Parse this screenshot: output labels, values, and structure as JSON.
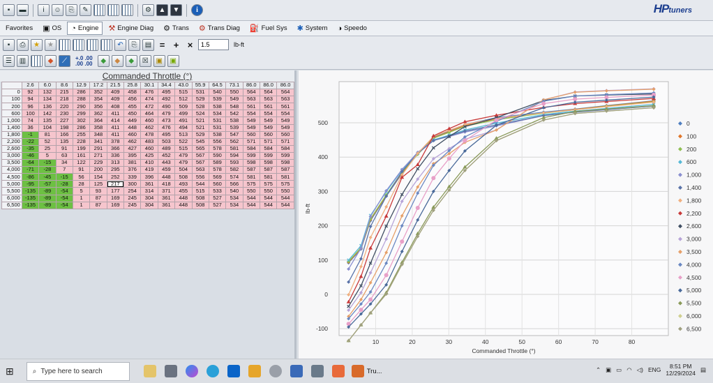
{
  "brand": {
    "logo_text": "HP",
    "logo_suffix": "tuners"
  },
  "nav_tabs": [
    {
      "label": "Favorites"
    },
    {
      "label": "OS"
    },
    {
      "label": "Engine"
    },
    {
      "label": "Engine Diag"
    },
    {
      "label": "Trans"
    },
    {
      "label": "Trans Diag"
    },
    {
      "label": "Fuel Sys"
    },
    {
      "label": "System"
    },
    {
      "label": "Speedo"
    }
  ],
  "editor": {
    "value_input": "1.5",
    "unit_label": "lb-ft",
    "decimals_up": "+.0 .00",
    "decimals_down": ".00 .00"
  },
  "table": {
    "title": "Commanded Throttle (°)",
    "col_headers": [
      "2.6",
      "6.0",
      "8.6",
      "12.9",
      "17.2",
      "21.5",
      "25.8",
      "30.1",
      "34.4",
      "43.0",
      "55.9",
      "64.5",
      "73.1",
      "86.0",
      "86.0",
      "86.0"
    ],
    "row_headers": [
      "0",
      "100",
      "200",
      "600",
      "1,000",
      "1,400",
      "1,800",
      "2,200",
      "2,600",
      "3,000",
      "3,500",
      "4,000",
      "4,500",
      "5,000",
      "5,500",
      "6,000",
      "6,500"
    ],
    "rows": [
      [
        92,
        132,
        215,
        286,
        352,
        409,
        458,
        476,
        495,
        515,
        531,
        540,
        550,
        564,
        564,
        564
      ],
      [
        94,
        134,
        218,
        288,
        354,
        409,
        456,
        474,
        492,
        512,
        529,
        539,
        549,
        563,
        563,
        563
      ],
      [
        96,
        136,
        220,
        290,
        356,
        408,
        455,
        472,
        490,
        509,
        528,
        538,
        548,
        561,
        561,
        561
      ],
      [
        100,
        142,
        230,
        299,
        362,
        411,
        450,
        464,
        479,
        499,
        524,
        534,
        542,
        554,
        554,
        554
      ],
      [
        74,
        135,
        227,
        302,
        364,
        414,
        449,
        460,
        473,
        491,
        521,
        531,
        538,
        549,
        549,
        549
      ],
      [
        36,
        104,
        198,
        286,
        358,
        411,
        448,
        462,
        476,
        494,
        521,
        531,
        539,
        549,
        549,
        549
      ],
      [
        -1,
        81,
        166,
        255,
        348,
        411,
        460,
        478,
        495,
        513,
        529,
        538,
        547,
        560,
        560,
        560
      ],
      [
        -22,
        52,
        135,
        228,
        341,
        378,
        462,
        483,
        503,
        522,
        545,
        556,
        562,
        571,
        571,
        571
      ],
      [
        -35,
        25,
        91,
        199,
        291,
        366,
        427,
        460,
        489,
        515,
        565,
        578,
        581,
        584,
        584,
        584
      ],
      [
        -46,
        5,
        63,
        161,
        271,
        336,
        395,
        425,
        452,
        479,
        567,
        590,
        594,
        599,
        599,
        599
      ],
      [
        -64,
        -15,
        34,
        122,
        229,
        313,
        381,
        410,
        443,
        479,
        567,
        589,
        593,
        598,
        598,
        598
      ],
      [
        -71,
        -28,
        7,
        91,
        200,
        295,
        376,
        419,
        459,
        504,
        563,
        578,
        582,
        587,
        587,
        587
      ],
      [
        -86,
        -45,
        -15,
        56,
        154,
        252,
        339,
        396,
        448,
        508,
        556,
        569,
        574,
        581,
        581,
        581
      ],
      [
        -95,
        -57,
        -28,
        28,
        125,
        217,
        300,
        361,
        418,
        493,
        544,
        560,
        566,
        575,
        575,
        575
      ],
      [
        -135,
        -89,
        -54,
        5,
        93,
        177,
        254,
        314,
        371,
        455,
        515,
        533,
        540,
        550,
        550,
        550
      ],
      [
        -135,
        -89,
        -54,
        1,
        87,
        169,
        245,
        304,
        361,
        448,
        508,
        527,
        534,
        544,
        544,
        544
      ],
      [
        -135,
        -89,
        -54,
        1,
        87,
        169,
        245,
        304,
        361,
        448,
        508,
        527,
        534,
        544,
        544,
        544
      ]
    ]
  },
  "chart_data": {
    "type": "line",
    "xlabel": "Commanded Throttle (°)",
    "ylabel": "lb-ft",
    "xlim": [
      0,
      90
    ],
    "ylim": [
      -120,
      620
    ],
    "xticks": [
      10,
      20,
      30,
      40,
      50,
      60,
      70,
      80
    ],
    "yticks": [
      -100,
      0,
      100,
      200,
      300,
      400,
      500
    ],
    "legend_position": "right",
    "grid": true,
    "x": [
      2.6,
      6.0,
      8.6,
      12.9,
      17.2,
      21.5,
      25.8,
      30.1,
      34.4,
      43.0,
      55.9,
      64.5,
      73.1,
      86.0,
      86.0,
      86.0
    ],
    "series": [
      {
        "name": "0",
        "color": "#4f7fc0",
        "marker": "diamond"
      },
      {
        "name": "100",
        "color": "#e0762a",
        "marker": "diamond"
      },
      {
        "name": "200",
        "color": "#8fbf52",
        "marker": "diamond"
      },
      {
        "name": "600",
        "color": "#55b8d6",
        "marker": "x"
      },
      {
        "name": "1,000",
        "color": "#8a8fd0",
        "marker": "diamond"
      },
      {
        "name": "1,400",
        "color": "#5a73a8",
        "marker": "diamond"
      },
      {
        "name": "1,800",
        "color": "#f0b080",
        "marker": "diamond"
      },
      {
        "name": "2,200",
        "color": "#c83a3a",
        "marker": "triangle"
      },
      {
        "name": "2,600",
        "color": "#3f4e62",
        "marker": "x"
      },
      {
        "name": "3,000",
        "color": "#b7a4d8",
        "marker": "diamond"
      },
      {
        "name": "3,500",
        "color": "#e6a06a",
        "marker": "diamond"
      },
      {
        "name": "4,000",
        "color": "#6a88c2",
        "marker": "diamond"
      },
      {
        "name": "4,500",
        "color": "#e8a0c8",
        "marker": "circle"
      },
      {
        "name": "5,000",
        "color": "#4a6a9a",
        "marker": "diamond"
      },
      {
        "name": "5,500",
        "color": "#8a9a5a",
        "marker": "triangle"
      },
      {
        "name": "6,000",
        "color": "#d0d090",
        "marker": "diamond"
      },
      {
        "name": "6,500",
        "color": "#a0a080",
        "marker": "diamond"
      }
    ]
  },
  "taskbar": {
    "search_placeholder": "Type here to search",
    "app_label": "Tru...",
    "language": "ENG",
    "time": "8:51 PM",
    "date": "12/29/2024"
  },
  "colors": {
    "negative_cell": "#6dc043",
    "positive_cell": "#f6c5cd",
    "brand": "#1c3e8f"
  }
}
